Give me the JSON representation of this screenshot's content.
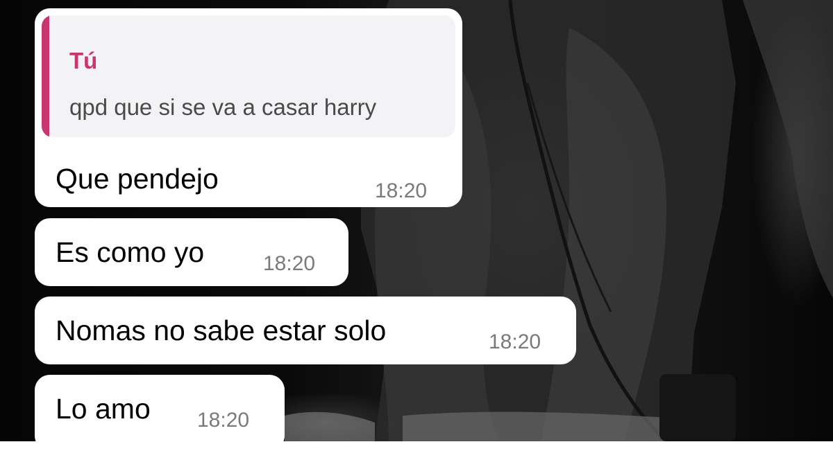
{
  "conversation": {
    "reply": {
      "author": "Tú",
      "quoted_text": "qpd que si se va a casar harry",
      "accent_color": "#c9356f"
    },
    "messages": [
      {
        "text": "Que pendejo",
        "time": "18:20"
      },
      {
        "text": "Es como yo",
        "time": "18:20"
      },
      {
        "text": "Nomas no sabe estar solo",
        "time": "18:20"
      },
      {
        "text": "Lo amo",
        "time": "18:20"
      }
    ]
  },
  "colors": {
    "bubble": "#ffffff",
    "quote_background": "#f3f2f4",
    "timestamp": "#7a7a7a",
    "wallpaper": "#0a0a0a"
  }
}
